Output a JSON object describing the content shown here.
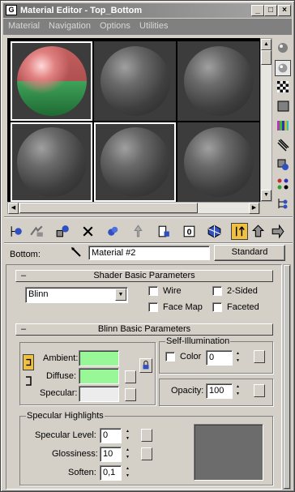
{
  "window": {
    "title": "Material Editor - Top_Bottom",
    "buttons": {
      "minimize": "_",
      "maximize": "□",
      "close": "×"
    }
  },
  "menu": [
    "Material",
    "Navigation",
    "Options",
    "Utilities"
  ],
  "slots": {
    "selected_index": 0,
    "count": 6
  },
  "material_row": {
    "label": "Bottom:",
    "material_name": "Material #2",
    "type_button": "Standard"
  },
  "shader": {
    "header": "Shader Basic Parameters",
    "collapse": "–",
    "shader_type": "Blinn",
    "wire": "Wire",
    "two_sided": "2-Sided",
    "face_map": "Face Map",
    "faceted": "Faceted"
  },
  "blinn": {
    "header": "Blinn Basic Parameters",
    "collapse": "–",
    "ambient_label": "Ambient:",
    "diffuse_label": "Diffuse:",
    "specular_label": "Specular:",
    "ambient_color": "#98f898",
    "diffuse_color": "#98f898",
    "specular_color": "#ececec",
    "self_illum_title": "Self-Illumination",
    "color_label": "Color",
    "color_value": "0",
    "opacity_label": "Opacity:",
    "opacity_value": "100"
  },
  "specular": {
    "title": "Specular Highlights",
    "level_label": "Specular Level:",
    "level_value": "0",
    "gloss_label": "Glossiness:",
    "gloss_value": "10",
    "soften_label": "Soften:",
    "soften_value": "0,1",
    "curve_color": "#6c6c6c"
  },
  "icons": {
    "side": [
      "sample-type-icon",
      "backlight-icon",
      "background-icon",
      "uv-tiling-icon",
      "video-color-check-icon",
      "make-preview-icon",
      "options-icon",
      "select-by-material-icon",
      "material-map-navigator-icon"
    ],
    "toolbar": [
      "get-material-icon",
      "put-to-scene-icon",
      "assign-to-selection-icon",
      "reset-map-icon",
      "make-unique-icon",
      "put-to-library-icon",
      "material-effects-channel-icon",
      "show-map-in-viewport-icon",
      "show-end-result-icon",
      "go-to-parent-icon",
      "go-forward-to-sibling-icon"
    ]
  }
}
